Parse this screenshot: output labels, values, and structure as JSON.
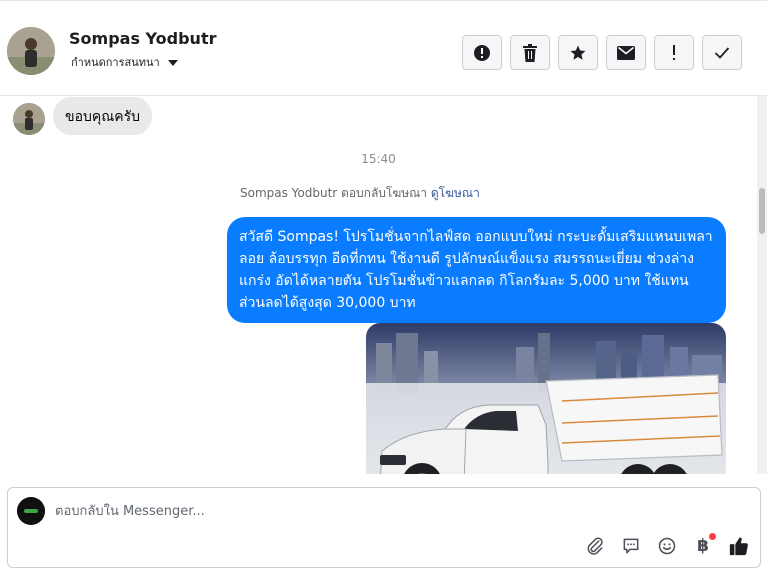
{
  "header": {
    "name": "Sompas Yodbutr",
    "assign_label": "กำหนดการสนทนา"
  },
  "actions": [
    {
      "name": "mark-spam-button",
      "icon": "alert-circle-icon"
    },
    {
      "name": "delete-button",
      "icon": "trash-icon"
    },
    {
      "name": "star-button",
      "icon": "star-icon"
    },
    {
      "name": "mark-unread-button",
      "icon": "envelope-icon"
    },
    {
      "name": "follow-up-button",
      "icon": "exclamation-icon"
    },
    {
      "name": "mark-done-button",
      "icon": "checkmark-icon"
    }
  ],
  "messages": {
    "incoming_text": "ขอบคุณครับ",
    "timestamp": "15:40",
    "meta_sender": "Sompas Yodbutr ตอบกลับโฆษณา",
    "meta_link": "ดูโฆษณา",
    "outgoing_text": "สวัสดี Sompas! โปรโมชั่นจากไลฟ์สด ออกแบบใหม่ กระบะดั้มเสริมแหนบเพลาลอย ล้อบรรทุก อีดที่กทน ใช้งานดี รูปลักษณ์แข็งแรง สมรรถนะเยี่ยม ช่วงล่างแกร่ง อัดได้หลายตัน โปรโมชั่นข้าวแลกลด กิโลกรัมละ 5,000 บาท ใช้แทนส่วนลดได้สูงสุด 30,000 บาท"
  },
  "composer": {
    "placeholder": "ตอบกลับใน Messenger..."
  },
  "colors": {
    "accent": "#0a7cff",
    "incoming_bubble": "#e9e9eb",
    "notification_dot": "#fa3e3e"
  }
}
